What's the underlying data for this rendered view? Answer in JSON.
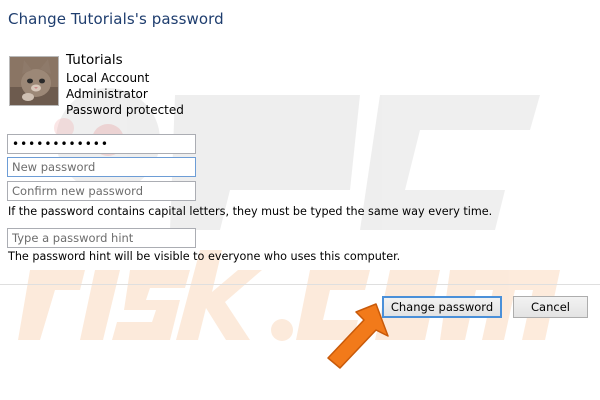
{
  "dialog": {
    "title": "Change Tutorials's password"
  },
  "account": {
    "name": "Tutorials",
    "type": "Local Account",
    "role": "Administrator",
    "status": "Password protected",
    "avatar_icon": "kitten-avatar-icon"
  },
  "form": {
    "current_password_value": "••••••••••••",
    "new_password_placeholder": "New password",
    "confirm_password_placeholder": "Confirm new password",
    "capital_letters_note": "If the password contains capital letters, they must be typed the same way every time.",
    "hint_placeholder": "Type a password hint",
    "hint_note": "The password hint will be visible to everyone who uses this computer."
  },
  "buttons": {
    "change_password": "Change password",
    "cancel": "Cancel"
  },
  "overlay": {
    "arrow_icon": "pointer-arrow-icon",
    "arrow_color": "#f27a1a",
    "watermark": "PC risk.com"
  }
}
